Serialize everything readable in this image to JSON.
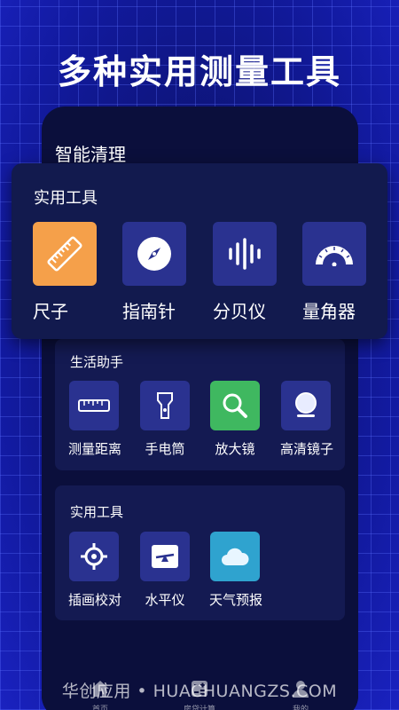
{
  "headline": "多种实用测量工具",
  "app": {
    "title": "智能清理",
    "sections": [
      {
        "title": "生活助手",
        "tools": [
          {
            "label": "测量距离",
            "icon": "tape-measure-icon"
          },
          {
            "label": "手电筒",
            "icon": "flashlight-icon"
          },
          {
            "label": "放大镜",
            "icon": "magnifier-icon"
          },
          {
            "label": "高清镜子",
            "icon": "mirror-icon"
          }
        ]
      },
      {
        "title": "实用工具",
        "tools": [
          {
            "label": "插画校对",
            "icon": "crosshair-icon"
          },
          {
            "label": "水平仪",
            "icon": "level-icon"
          },
          {
            "label": "天气预报",
            "icon": "weather-cloud-icon"
          }
        ]
      }
    ],
    "nav": [
      {
        "label": "首页",
        "icon": "home-icon"
      },
      {
        "label": "房贷计算",
        "icon": "calculator-icon"
      },
      {
        "label": "我的",
        "icon": "profile-icon"
      }
    ]
  },
  "overlay": {
    "title": "实用工具",
    "tools": [
      {
        "label": "尺子",
        "icon": "ruler-icon"
      },
      {
        "label": "指南针",
        "icon": "compass-icon"
      },
      {
        "label": "分贝仪",
        "icon": "decibel-icon"
      },
      {
        "label": "量角器",
        "icon": "protractor-icon"
      }
    ]
  },
  "watermark": "华创应用 • HUACHUANGZS.COM",
  "colors": {
    "accent_orange": "#f5a04a",
    "accent_green": "#3fb860",
    "accent_cyan": "#2fa3cf",
    "tile_blue": "#2a3290",
    "panel": "#141a52",
    "background": "#0a1070"
  }
}
